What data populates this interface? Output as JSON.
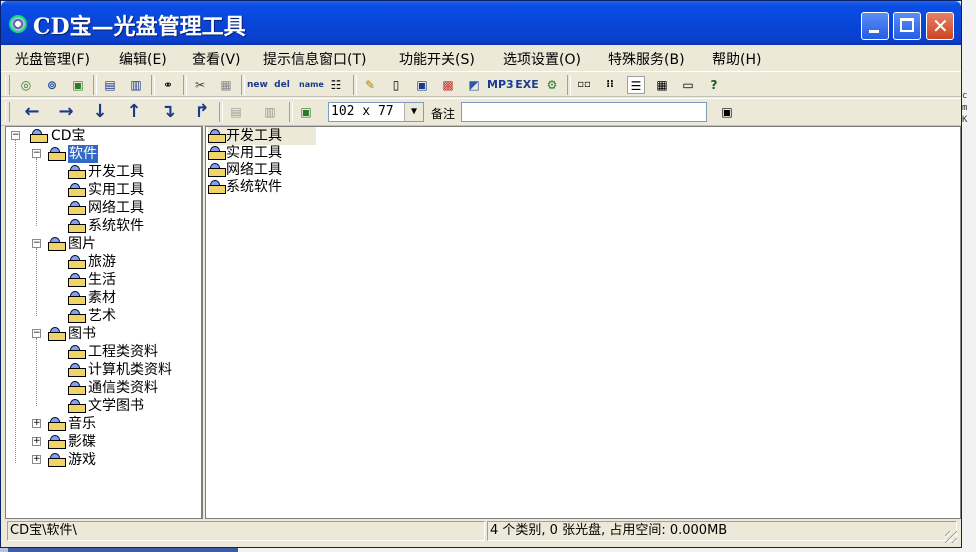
{
  "window": {
    "title": "CD宝—光盘管理工具",
    "buttons": {
      "minimize": "—",
      "maximize": "□",
      "close": "✕"
    }
  },
  "menu": [
    {
      "label": "光盘管理(F)"
    },
    {
      "label": "编辑(E)"
    },
    {
      "label": "查看(V)"
    },
    {
      "label": "提示信息窗口(T)"
    },
    {
      "label": "功能开关(S)"
    },
    {
      "label": "选项设置(O)"
    },
    {
      "label": "特殊服务(B)"
    },
    {
      "label": "帮助(H)"
    }
  ],
  "toolbar1": {
    "icons": [
      "cd-scan-icon",
      "cd-search-icon",
      "cd-copy-icon",
      "cd-import-icon",
      "cd-export-icon",
      "binoculars-icon",
      "cut-icon",
      "paste-icon",
      "new-folder-icon",
      "delete-folder-icon",
      "rename-icon",
      "tree-icon",
      "edit-icon",
      "note-icon",
      "disk-icon",
      "image-icon",
      "3d-box-icon",
      "mp3-icon",
      "exe-icon",
      "tools-icon",
      "small-icons-icon",
      "list-icon",
      "details-icon",
      "grid-icon",
      "window-icon",
      "help-icon"
    ],
    "labels": {
      "mp3": "MP3",
      "exe": "EXE",
      "new": "new",
      "del": "del",
      "name": "name"
    }
  },
  "toolbar2": {
    "arrows": [
      "←",
      "→",
      "↓",
      "↑",
      "↴",
      "↱"
    ],
    "combo_value": "102 x 77",
    "note_label": "备注",
    "note_value": ""
  },
  "tree": {
    "root": "CD宝",
    "nodes": [
      {
        "label": "软件",
        "selected": true,
        "expanded": true,
        "children": [
          "开发工具",
          "实用工具",
          "网络工具",
          "系统软件"
        ]
      },
      {
        "label": "图片",
        "expanded": true,
        "children": [
          "旅游",
          "生活",
          "素材",
          "艺术"
        ]
      },
      {
        "label": "图书",
        "expanded": true,
        "children": [
          "工程类资料",
          "计算机类资料",
          "通信类资料",
          "文学图书"
        ]
      },
      {
        "label": "音乐",
        "expanded": false,
        "children": []
      },
      {
        "label": "影碟",
        "expanded": false,
        "children": []
      },
      {
        "label": "游戏",
        "expanded": false,
        "children": []
      }
    ]
  },
  "list": {
    "items": [
      "开发工具",
      "实用工具",
      "网络工具",
      "系统软件"
    ]
  },
  "status": {
    "path": "CD宝\\软件\\",
    "summary": "4 个类别, 0 张光盘, 占用空间: 0.000MB"
  },
  "desktop": {
    "edge_text": [
      "c",
      "m",
      "K"
    ]
  }
}
